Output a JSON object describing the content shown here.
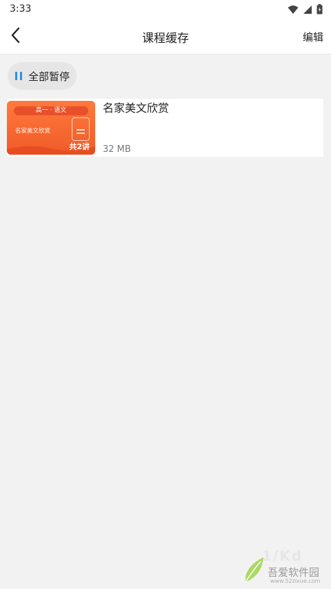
{
  "status_bar": {
    "time": "3:33",
    "icons": [
      "wifi-icon",
      "signal-icon",
      "battery-icon"
    ]
  },
  "header": {
    "back_icon": "chevron-left-icon",
    "title": "课程缓存",
    "edit_label": "编辑"
  },
  "toolbar": {
    "pause_icon": "pause-icon",
    "pause_all_label": "全部暂停",
    "accent_color": "#2f8fe0"
  },
  "courses": [
    {
      "title": "名家美文欣赏",
      "size": "32 MB",
      "thumbnail": {
        "banner": "高一 · 语文",
        "subtitle": "名家美文欣赏",
        "count": "共2讲"
      }
    }
  ],
  "watermark": {
    "brand": "1/Kd",
    "name": "吾爱软件园",
    "url": "www.52zixue.com"
  },
  "colors": {
    "background": "#f2f2f2",
    "thumbnail_orange": "#f05a28"
  }
}
